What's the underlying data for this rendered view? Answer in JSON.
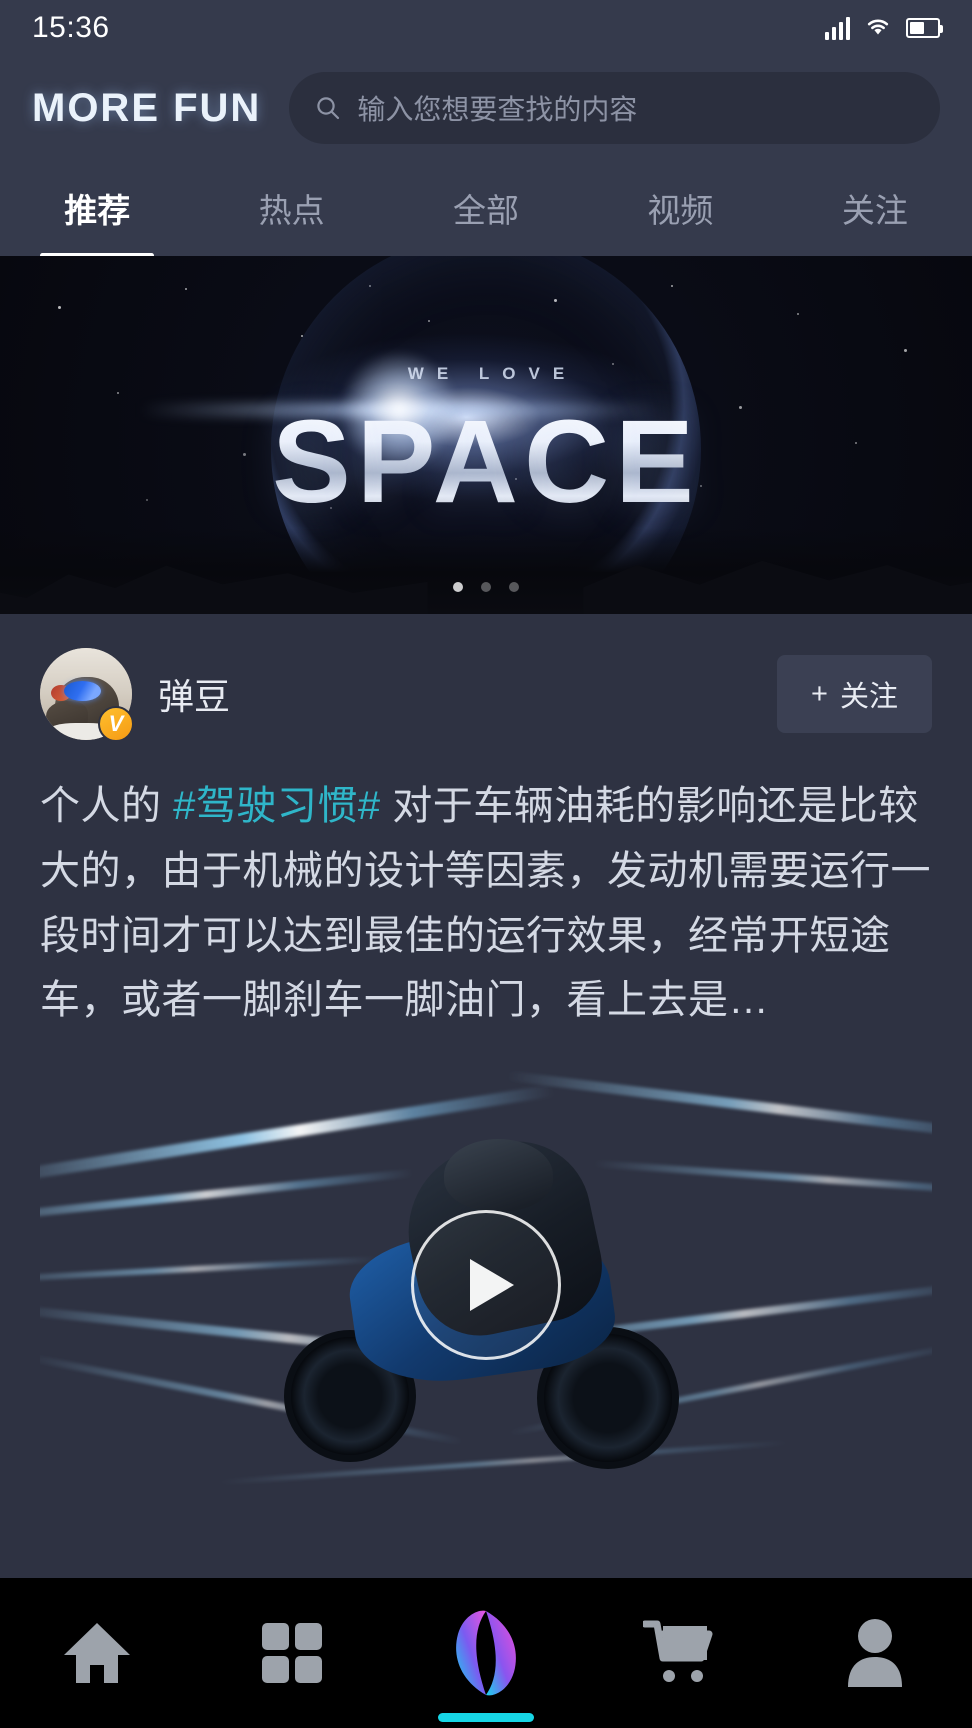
{
  "status_bar": {
    "time": "15:36",
    "icons": [
      "signal-icon",
      "wifi-icon",
      "battery-icon"
    ]
  },
  "header": {
    "logo": "MORE FUN",
    "search": {
      "placeholder": "输入您想要查找的内容",
      "value": "",
      "icon": "search-icon"
    }
  },
  "tabs": {
    "items": [
      {
        "label": "推荐",
        "active": true
      },
      {
        "label": "热点",
        "active": false
      },
      {
        "label": "全部",
        "active": false
      },
      {
        "label": "视频",
        "active": false
      },
      {
        "label": "关注",
        "active": false
      }
    ]
  },
  "banner": {
    "kicker": "WE LOVE",
    "title": "SPACE",
    "dots": {
      "count": 3,
      "active_index": 0
    }
  },
  "post": {
    "author": {
      "name": "弹豆",
      "avatar": "dog-avatar",
      "verified_badge": "V"
    },
    "follow_button": {
      "plus": "+",
      "label": "关注"
    },
    "text_parts": [
      {
        "type": "plain",
        "text": "个人的 "
      },
      {
        "type": "hashtag",
        "text": "#驾驶习惯#"
      },
      {
        "type": "plain",
        "text": " 对于车辆油耗的影响还是比较大的，由于机械的设计等因素，发动机需要运行一段时间才可以达到最佳的运行效果，经常开短途车，或者一脚刹车一脚油门，看上去是…"
      }
    ],
    "media": {
      "type": "video",
      "play_icon": "play-icon",
      "description": "motorcycle-night-ride"
    }
  },
  "bottom_nav": {
    "items": [
      {
        "name": "home",
        "icon": "home-icon",
        "active": false
      },
      {
        "name": "category",
        "icon": "grid-icon",
        "active": false
      },
      {
        "name": "create",
        "icon": "aperture-logo-icon",
        "active": true
      },
      {
        "name": "cart",
        "icon": "cart-icon",
        "active": false
      },
      {
        "name": "profile",
        "icon": "person-icon",
        "active": false
      }
    ],
    "home_indicator_color": "#17d6e6"
  },
  "colors": {
    "app_bg": "#2e3242",
    "chrome_bg": "#353a4c",
    "hashtag": "#2fb6c9",
    "accent": "#17d6e6",
    "nav_bg": "#000000",
    "badge": "#f5a51a"
  }
}
